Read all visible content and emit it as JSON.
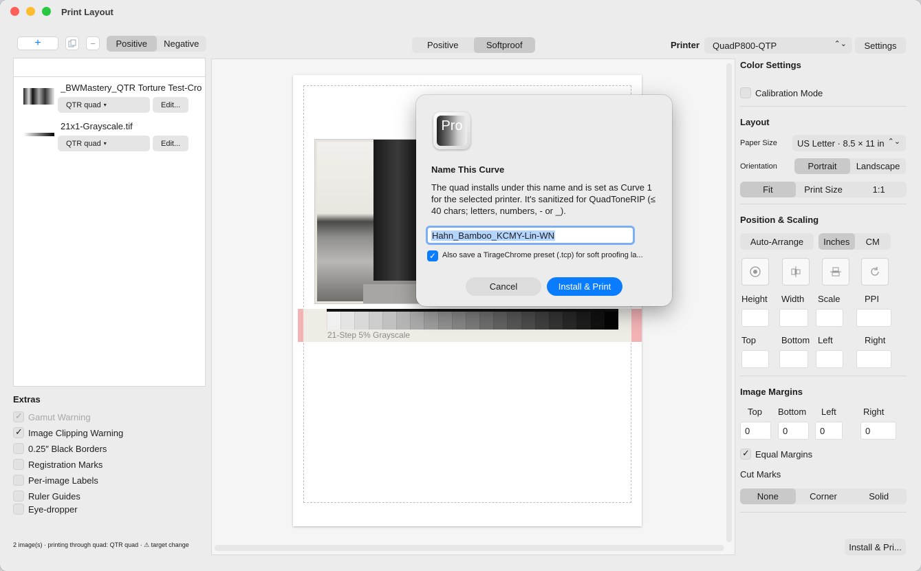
{
  "window": {
    "title": "Print Layout"
  },
  "toolbar": {
    "add_label": "+",
    "left_mode": [
      "Positive",
      "Negative"
    ],
    "center_mode": [
      "Positive",
      "Softproof"
    ],
    "printer_label": "Printer",
    "printer_value": "QuadP800-QTP",
    "settings_label": "Settings"
  },
  "images": [
    {
      "name": "_BWMastery_QTR Torture Test-Cro",
      "profile": "QTR quad",
      "edit": "Edit..."
    },
    {
      "name": "21x1-Grayscale.tif",
      "profile": "QTR quad",
      "edit": "Edit..."
    }
  ],
  "extras": {
    "title": "Extras",
    "items": [
      {
        "label": "Gamut Warning",
        "checked": true,
        "disabled": true
      },
      {
        "label": "Image Clipping Warning",
        "checked": true,
        "disabled": false
      },
      {
        "label": "0.25″ Black Borders",
        "checked": false,
        "disabled": false
      },
      {
        "label": "Registration Marks",
        "checked": false,
        "disabled": false
      },
      {
        "label": "Per-image Labels",
        "checked": false,
        "disabled": false
      },
      {
        "label": "Ruler Guides",
        "checked": false,
        "disabled": false
      },
      {
        "label": "Eye-dropper",
        "checked": false,
        "disabled": false
      }
    ]
  },
  "status": "2 image(s) · printing through quad: QTR quad · ⚠ target change",
  "canvas": {
    "strip_label": "21-Step 5% Grayscale"
  },
  "right": {
    "color_settings": "Color Settings",
    "calibration_mode": "Calibration Mode",
    "layout": "Layout",
    "paper_size_label": "Paper Size",
    "paper_size_value": "US Letter · 8.5 × 11 in",
    "orientation_label": "Orientation",
    "orientation": [
      "Portrait",
      "Landscape"
    ],
    "fit": [
      "Fit",
      "Print Size",
      "1:1"
    ],
    "position_scaling": "Position & Scaling",
    "auto_arrange": "Auto-Arrange",
    "units": [
      "Inches",
      "CM"
    ],
    "dim_labels": [
      "Height",
      "Width",
      "Scale",
      "PPI"
    ],
    "pos_labels": [
      "Top",
      "Bottom",
      "Left",
      "Right"
    ],
    "image_margins": "Image Margins",
    "margin_labels": [
      "Top",
      "Bottom",
      "Left",
      "Right"
    ],
    "margin_values": [
      "0",
      "0",
      "0",
      "0"
    ],
    "equal_margins": "Equal Margins",
    "cut_marks": "Cut Marks",
    "cut_options": [
      "None",
      "Corner",
      "Solid"
    ],
    "install_print": "Install & Pri..."
  },
  "dialog": {
    "title": "Name This Curve",
    "message": "The quad installs under this name and is set as Curve 1 for the selected printer. It's sanitized for QuadToneRIP (≤ 40 chars; letters, numbers, - or _).",
    "input_value": "Hahn_Bamboo_KCMY-Lin-WN",
    "checkbox_label": "Also save a TirageChrome preset (.tcp) for soft proofing la...",
    "cancel": "Cancel",
    "confirm": "Install & Print",
    "icon_text": "Pro"
  },
  "colors": {
    "accent": "#0a7cff",
    "close": "#ff5f57",
    "minimize": "#febc2e",
    "zoom": "#28c840"
  }
}
